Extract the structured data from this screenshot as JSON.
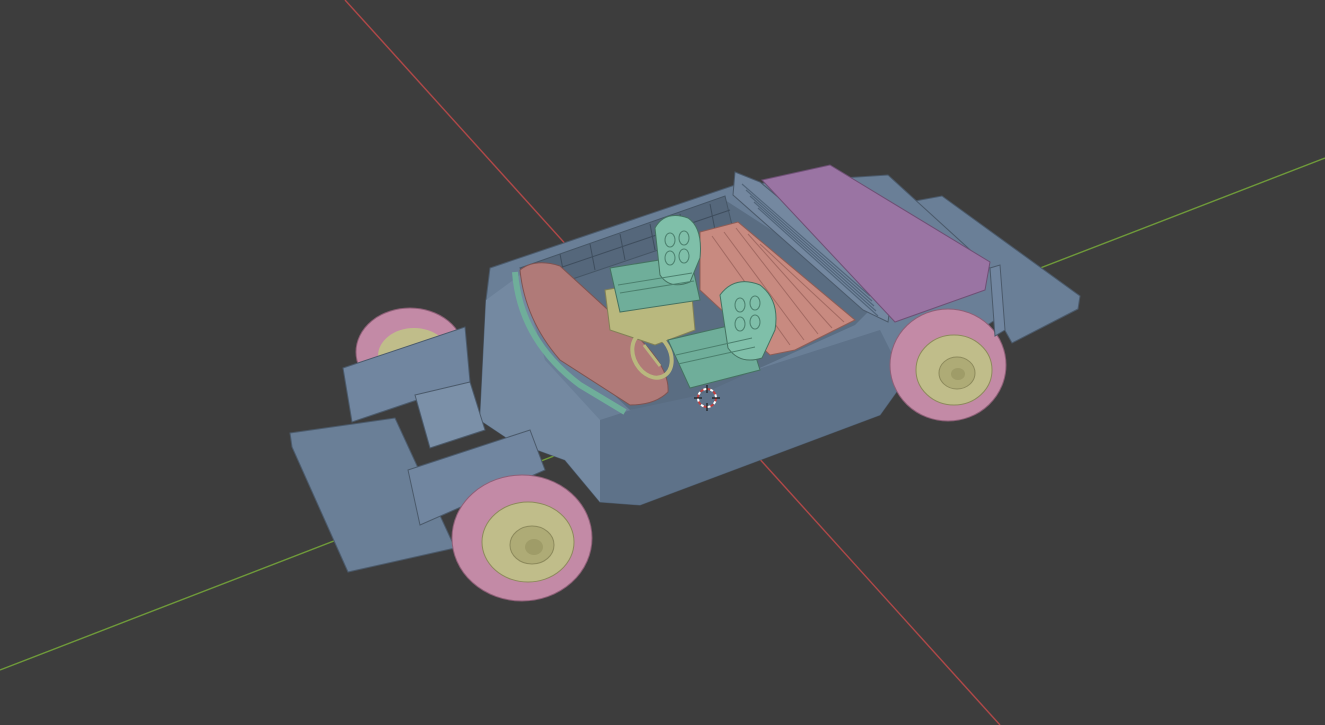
{
  "viewport": {
    "background_color": "#3d3d3d",
    "x_axis_color": "#b04848",
    "y_axis_color": "#6f9a3a",
    "cursor_color": "#c04040"
  },
  "scene": {
    "object": "car-chassis-model",
    "colors": {
      "body": "#6a7f97",
      "body_dark": "#586b80",
      "body_light": "#7e93ab",
      "trunk": "#9a74a3",
      "seat": "#6fae9a",
      "seat_light": "#86c6b0",
      "bench": "#c88a80",
      "dashboard": "#b07a78",
      "tire": "#c38aa6",
      "rim": "#c0bd8a",
      "console": "#b9b87e"
    }
  },
  "icons": {
    "cursor": "3d-cursor-icon"
  }
}
